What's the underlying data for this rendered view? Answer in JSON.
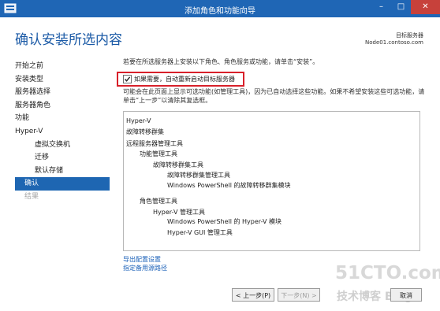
{
  "window": {
    "title": "添加角色和功能向导",
    "controls": {
      "minimize": "–",
      "maximize": "□",
      "close": "✕"
    }
  },
  "header": {
    "page_title": "确认安装所选内容",
    "server_label": "目标服务器",
    "server_name": "Node01.contoso.com"
  },
  "nav": {
    "items": [
      {
        "label": "开始之前",
        "state": "normal"
      },
      {
        "label": "安装类型",
        "state": "normal"
      },
      {
        "label": "服务器选择",
        "state": "normal"
      },
      {
        "label": "服务器角色",
        "state": "normal"
      },
      {
        "label": "功能",
        "state": "normal"
      },
      {
        "label": "Hyper-V",
        "state": "normal"
      },
      {
        "label": "虚拟交换机",
        "state": "sub"
      },
      {
        "label": "迁移",
        "state": "sub"
      },
      {
        "label": "默认存储",
        "state": "sub"
      },
      {
        "label": "确认",
        "state": "active"
      },
      {
        "label": "结果",
        "state": "disabled"
      }
    ]
  },
  "main": {
    "intro": "若要在所选服务器上安装以下角色、角色服务或功能，请单击“安装”。",
    "restart_checkbox": {
      "label": "如果需要，自动重新启动目标服务器",
      "checked": true
    },
    "note": "可能会在此页面上显示可选功能(如管理工具)，因为已自动选择这些功能。如果不希望安装这些可选功能，请单击“上一步”以清除其复选框。",
    "features": [
      "Hyper-V",
      "故障转移群集",
      "远程服务器管理工具",
      "功能管理工具",
      "故障转移群集工具",
      "故障转移群集管理工具",
      "Windows PowerShell 的故障转移群集模块",
      "角色管理工具",
      "Hyper-V 管理工具",
      "Windows PowerShell 的 Hyper-V 模块",
      "Hyper-V GUI 管理工具"
    ],
    "links": {
      "export": "导出配置设置",
      "alt_source": "指定备用源路径"
    }
  },
  "buttons": {
    "previous": "< 上一步(P)",
    "next": "下一步(N) >",
    "cancel": "取消"
  },
  "watermark": {
    "line1": "51CTO.com",
    "line2": "技术博客 Blog"
  },
  "colors": {
    "titlebar": "#1f66b5",
    "accent": "#1e66b2",
    "highlight_border": "#d8202a",
    "link": "#1c62b9"
  }
}
